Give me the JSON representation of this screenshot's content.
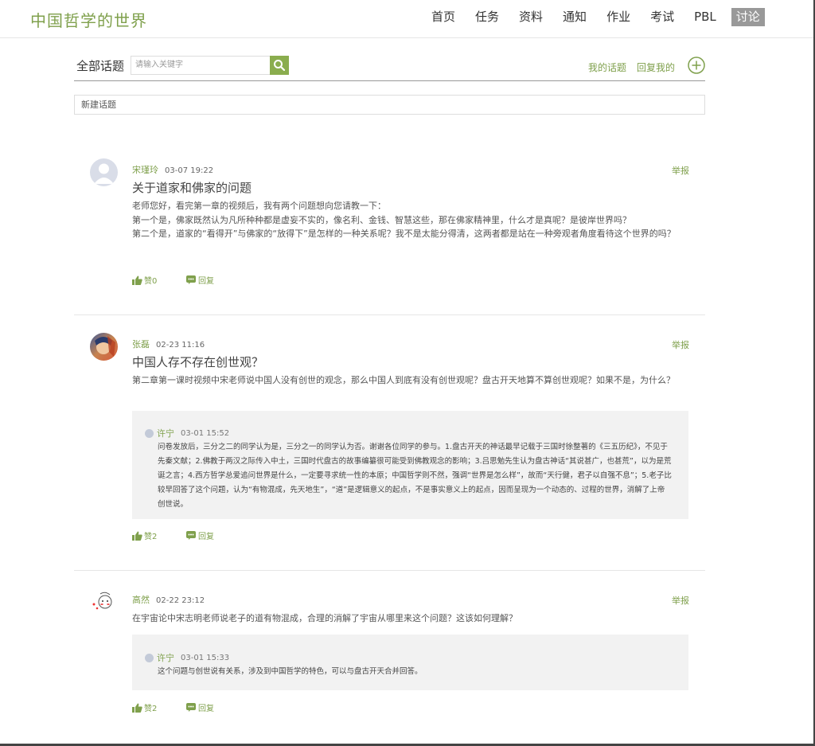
{
  "header": {
    "logo": "中国哲学的世界",
    "nav": [
      "首页",
      "任务",
      "资料",
      "通知",
      "作业",
      "考试",
      "PBL",
      "讨论"
    ]
  },
  "toolbar": {
    "all_topics": "全部话题",
    "search_placeholder": "请输入关键字",
    "my_topics": "我的话题",
    "reply_mine": "回复我的"
  },
  "new_topic": "新建话题",
  "posts": [
    {
      "author": "宋瑾玲",
      "time": "03-07 19:22",
      "report": "举报",
      "title": "关于道家和佛家的问题",
      "body": [
        "老师您好，看完第一章的视频后，我有两个问题想向您请教一下：",
        "第一个是，佛家既然认为凡所种种都是虚妄不实的，像名利、金钱、智慧这些，那在佛家精神里，什么才是真呢？是彼岸世界吗？",
        "第二个是，道家的“看得开”与佛家的“放得下”是怎样的一种关系呢？我不是太能分得清，这两者都是站在一种旁观者角度看待这个世界的吗？"
      ],
      "likes": "赞0",
      "reply": "回复"
    },
    {
      "author": "张磊",
      "time": "02-23 11:16",
      "report": "举报",
      "title": "中国人存不存在创世观？",
      "body": [
        "第二章第一课时视频中宋老师说中国人没有创世的观念，那么中国人到底有没有创世观呢？盘古开天地算不算创世观呢？如果不是，为什么？"
      ],
      "reply_item": {
        "author": "许宁",
        "time": "03-01 15:52",
        "text": "问卷发放后，三分之二的同学认为是，三分之一的同学认为否。谢谢各位同学的参与。1.盘古开天的神话最早记载于三国时徐整著的《三五历纪》，不见于先秦文献；2.佛教于两汉之际传入中土，三国时代盘古的故事编纂很可能受到佛教观念的影响；3.吕思勉先生认为盘古神话“其说甚广，也甚荒”，以为是荒诞之言；4.西方哲学总爱追问世界是什么，一定要寻求统一性的本原；中国哲学则不然，强调“世界是怎么样”，故而“天行健，君子以自强不息”；5.老子比较早回答了这个问题，认为“有物混成，先天地生”，“道”是逻辑意义的起点，不是事实意义上的起点，因而呈现为一个动态的、过程的世界，消解了上帝创世说。"
      },
      "likes": "赞2",
      "reply": "回复"
    },
    {
      "author": "高然",
      "time": "02-22 23:12",
      "report": "举报",
      "title": "",
      "body": [
        "在宇宙论中宋志明老师说老子的道有物混成，合理的消解了宇宙从哪里来这个问题？这该如何理解？"
      ],
      "reply_item": {
        "author": "许宁",
        "time": "03-01 15:33",
        "text": "这个问题与创世说有关系，涉及到中国哲学的特色，可以与盘古开天合并回答。"
      },
      "likes": "赞2",
      "reply": "回复"
    }
  ],
  "colors": {
    "accent": "#7fa04c",
    "search_button": "#8aad4e",
    "active_nav": "#999999"
  }
}
